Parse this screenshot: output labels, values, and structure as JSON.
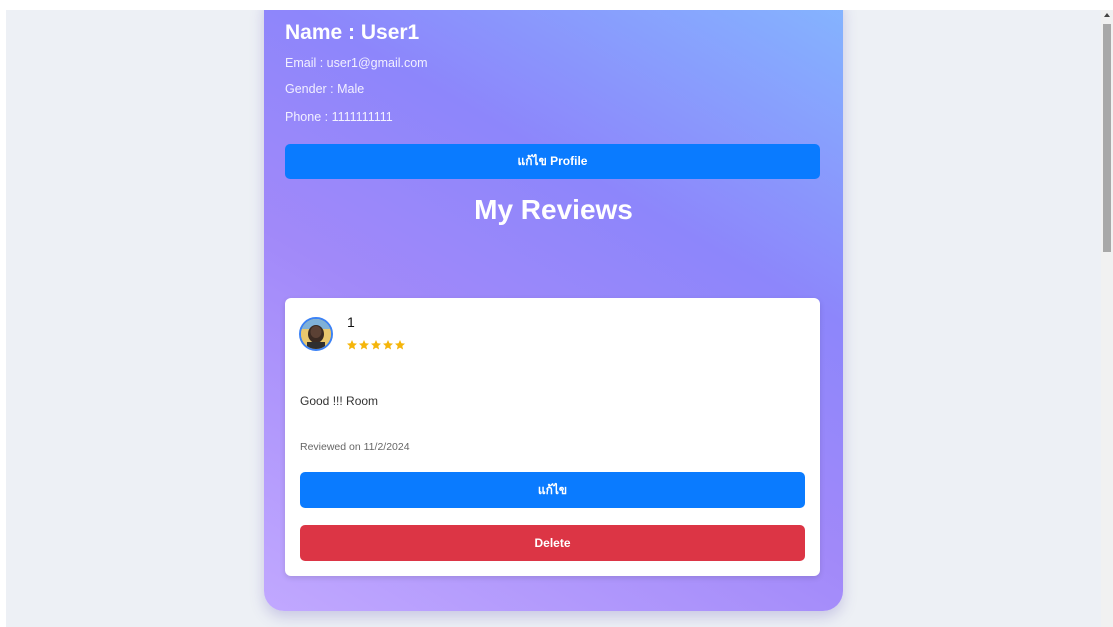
{
  "profile": {
    "name_line": "Name : User1",
    "email_line": "Email : user1@gmail.com",
    "gender_line": "Gender : Male",
    "phone_line": "Phone : 1111111111",
    "edit_button_label": "แก้ไข Profile"
  },
  "reviews_section": {
    "title": "My Reviews",
    "reviews": [
      {
        "user": "1",
        "rating": 5,
        "rating_max": 5,
        "text": "Good !!! Room",
        "date_line": "Reviewed on 11/2/2024",
        "edit_label": "แก้ไข",
        "delete_label": "Delete"
      }
    ]
  },
  "colors": {
    "primary_button": "#0a7bff",
    "danger_button": "#dc3545",
    "star": "#f5b50a",
    "page_background": "#edf0f5"
  },
  "icons": {
    "avatar": "user-avatar-photo",
    "rating": "star-icon"
  }
}
